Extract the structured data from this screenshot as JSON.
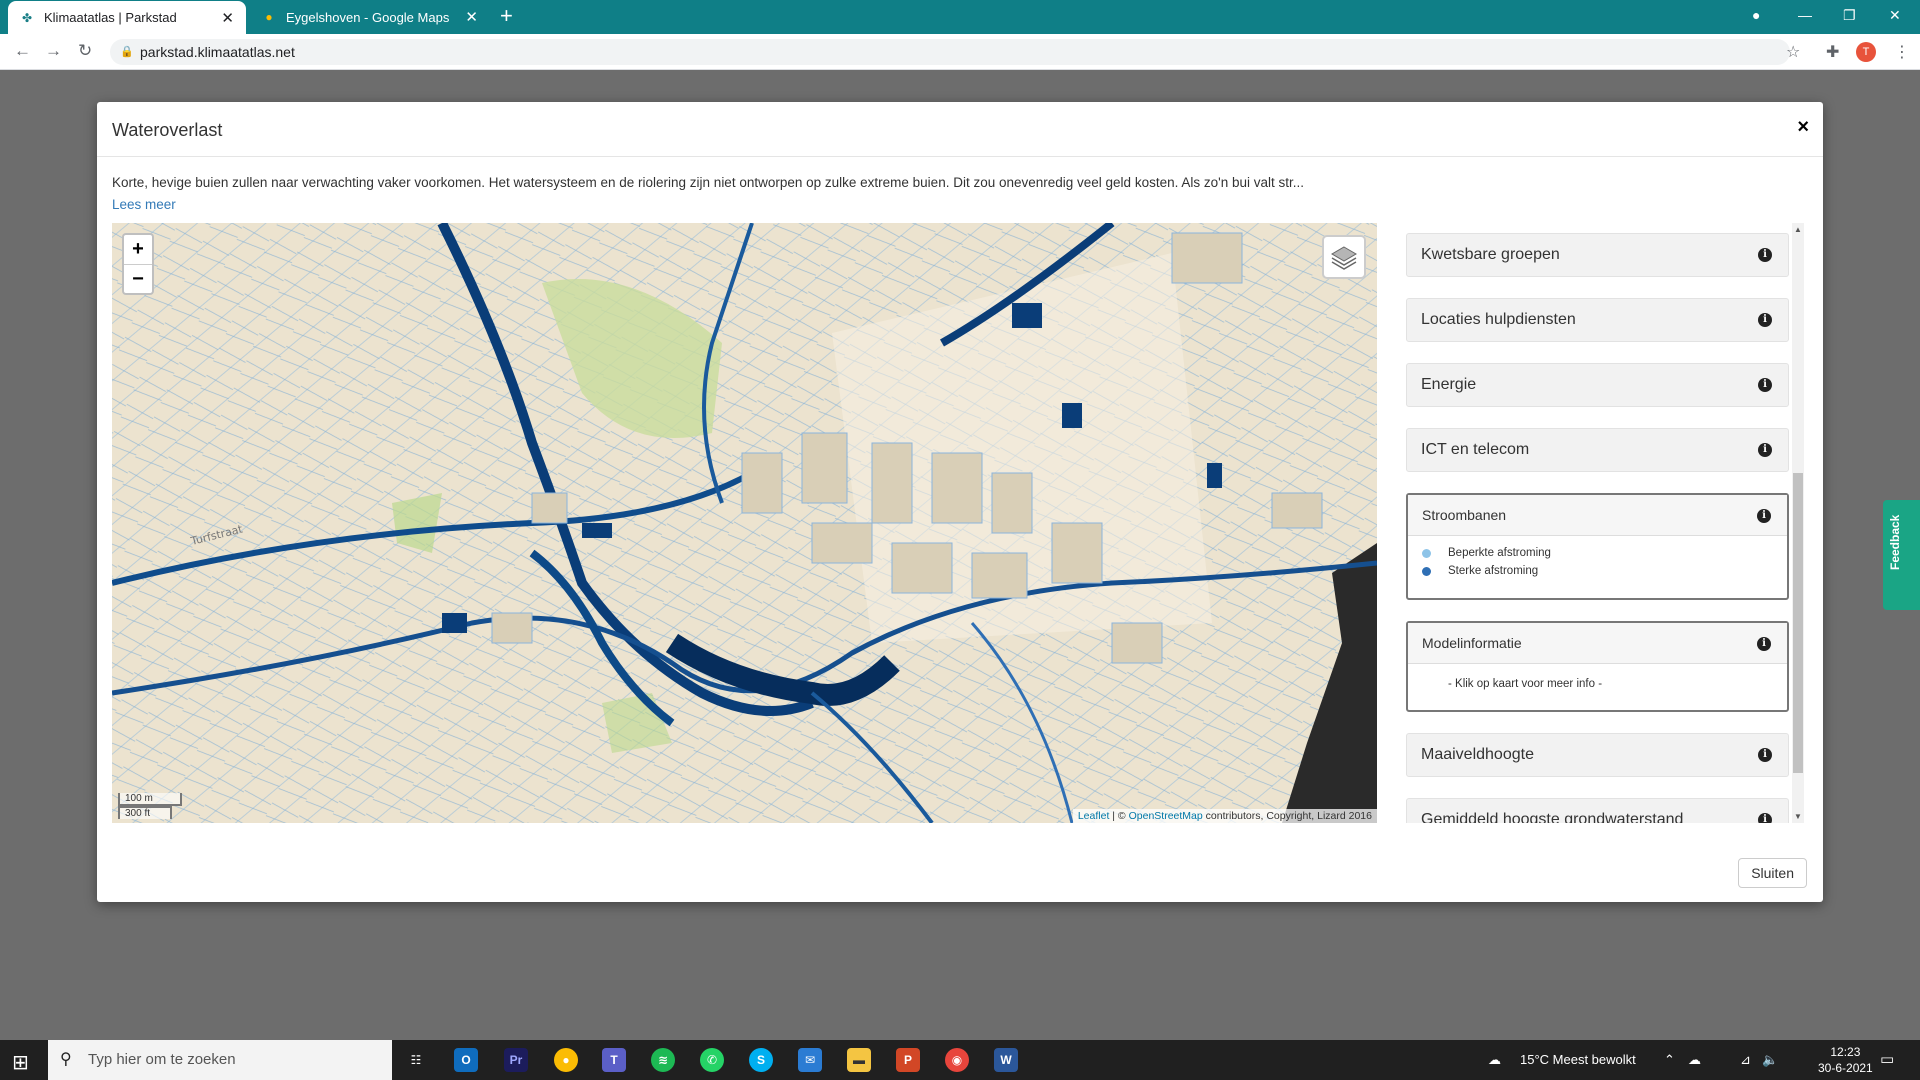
{
  "browser": {
    "tabs": [
      {
        "title": "Klimaatatlas | Parkstad",
        "active": true
      },
      {
        "title": "Eygelshoven - Google Maps",
        "active": false
      }
    ],
    "url": "parkstad.klimaatatlas.net",
    "avatar_letter": "T"
  },
  "modal": {
    "title": "Wateroverlast",
    "description": "Korte, hevige buien zullen naar verwachting vaker voorkomen. Het watersysteem en de riolering zijn niet ontworpen op zulke extreme buien. Dit zou onevenredig veel geld kosten. Als zo'n bui valt str...",
    "read_more": "Lees meer",
    "close_button": "Sluiten"
  },
  "map": {
    "zoom_in": "+",
    "zoom_out": "−",
    "scale_metric": "100 m",
    "scale_imperial": "300 ft",
    "street_label": "Turfstraat",
    "attribution": {
      "leaflet": "Leaflet",
      "sep": " | © ",
      "osm": "OpenStreetMap",
      "rest": " contributors, Copyright, Lizard 2016"
    }
  },
  "layers": [
    {
      "name": "Kwetsbare groepen"
    },
    {
      "name": "Locaties hulpdiensten"
    },
    {
      "name": "Energie"
    },
    {
      "name": "ICT en telecom"
    },
    {
      "name": "Stroombanen",
      "legend": [
        {
          "label": "Beperkte afstroming",
          "color": "#8ec4e8"
        },
        {
          "label": "Sterke afstroming",
          "color": "#2f6fb5"
        }
      ]
    },
    {
      "name": "Modelinformatie",
      "note": "- Klik op kaart voor meer info -"
    },
    {
      "name": "Maaiveldhoogte"
    },
    {
      "name": "Gemiddeld hoogste grondwaterstand"
    }
  ],
  "feedback_label": "Feedback",
  "taskbar": {
    "search_placeholder": "Typ hier om te zoeken",
    "weather": "15°C  Meest bewolkt",
    "time": "12:23",
    "date": "30-6-2021"
  },
  "colors": {
    "browser_teal": "#0f7f87",
    "water_dark": "#0a3d78",
    "water_light": "#8ec4e8",
    "map_ground": "#ece3cf",
    "feedback_green": "#1aa585"
  }
}
